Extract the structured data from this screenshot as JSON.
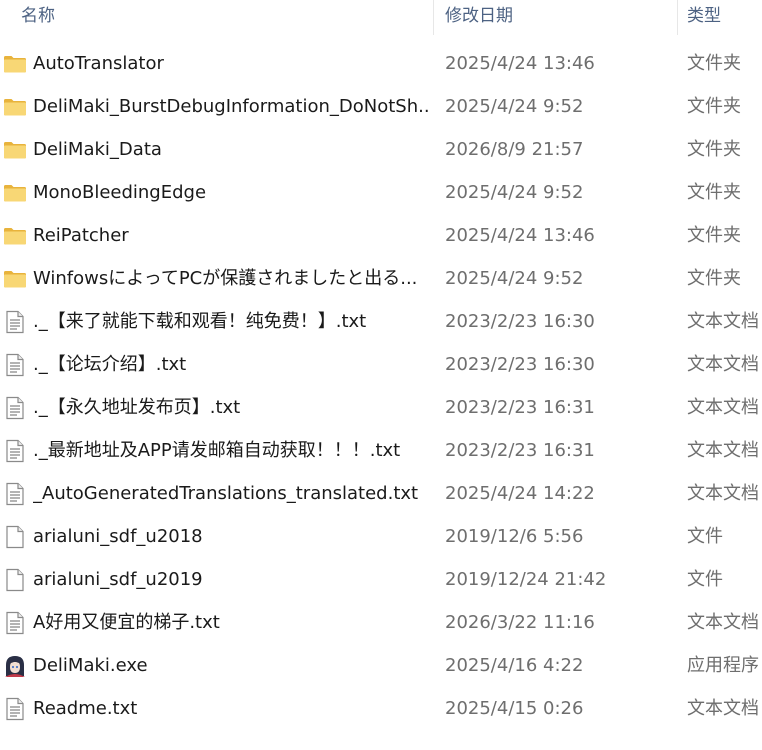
{
  "header": {
    "name_label": "名称",
    "date_label": "修改日期",
    "type_label": "类型",
    "sort_indicator": "^"
  },
  "colors": {
    "folder": "#f8d775",
    "folder_dark": "#e8b33c",
    "header_text": "#4d6283",
    "secondary_text": "#6e6e6e"
  },
  "rows": [
    {
      "icon": "folder-icon",
      "name": "AutoTranslator",
      "date": "2025/4/24 13:46",
      "type": "文件夹"
    },
    {
      "icon": "folder-icon",
      "name": "DeliMaki_BurstDebugInformation_DoNotSh...",
      "date": "2025/4/24 9:52",
      "type": "文件夹"
    },
    {
      "icon": "folder-icon",
      "name": "DeliMaki_Data",
      "date": "2026/8/9 21:57",
      "type": "文件夹"
    },
    {
      "icon": "folder-icon",
      "name": "MonoBleedingEdge",
      "date": "2025/4/24 9:52",
      "type": "文件夹"
    },
    {
      "icon": "folder-icon",
      "name": "ReiPatcher",
      "date": "2025/4/24 13:46",
      "type": "文件夹"
    },
    {
      "icon": "folder-icon",
      "name": "WinfowsによってPCが保護されましたと出る...",
      "date": "2025/4/24 9:52",
      "type": "文件夹"
    },
    {
      "icon": "text-file-icon",
      "name": "._【来了就能下载和观看！纯免费！】.txt",
      "date": "2023/2/23 16:30",
      "type": "文本文档"
    },
    {
      "icon": "text-file-icon",
      "name": "._【论坛介绍】.txt",
      "date": "2023/2/23 16:30",
      "type": "文本文档"
    },
    {
      "icon": "text-file-icon",
      "name": "._【永久地址发布页】.txt",
      "date": "2023/2/23 16:31",
      "type": "文本文档"
    },
    {
      "icon": "text-file-icon",
      "name": "._最新地址及APP请发邮箱自动获取！！！.txt",
      "date": "2023/2/23 16:31",
      "type": "文本文档"
    },
    {
      "icon": "text-file-icon",
      "name": "_AutoGeneratedTranslations_translated.txt",
      "date": "2025/4/24 14:22",
      "type": "文本文档"
    },
    {
      "icon": "blank-file-icon",
      "name": "arialuni_sdf_u2018",
      "date": "2019/12/6 5:56",
      "type": "文件"
    },
    {
      "icon": "blank-file-icon",
      "name": "arialuni_sdf_u2019",
      "date": "2019/12/24 21:42",
      "type": "文件"
    },
    {
      "icon": "text-file-icon",
      "name": "A好用又便宜的梯子.txt",
      "date": "2026/3/22 11:16",
      "type": "文本文档"
    },
    {
      "icon": "app-icon",
      "name": "DeliMaki.exe",
      "date": "2025/4/16 4:22",
      "type": "应用程序"
    },
    {
      "icon": "text-file-icon",
      "name": "Readme.txt",
      "date": "2025/4/15 0:26",
      "type": "文本文档"
    }
  ]
}
